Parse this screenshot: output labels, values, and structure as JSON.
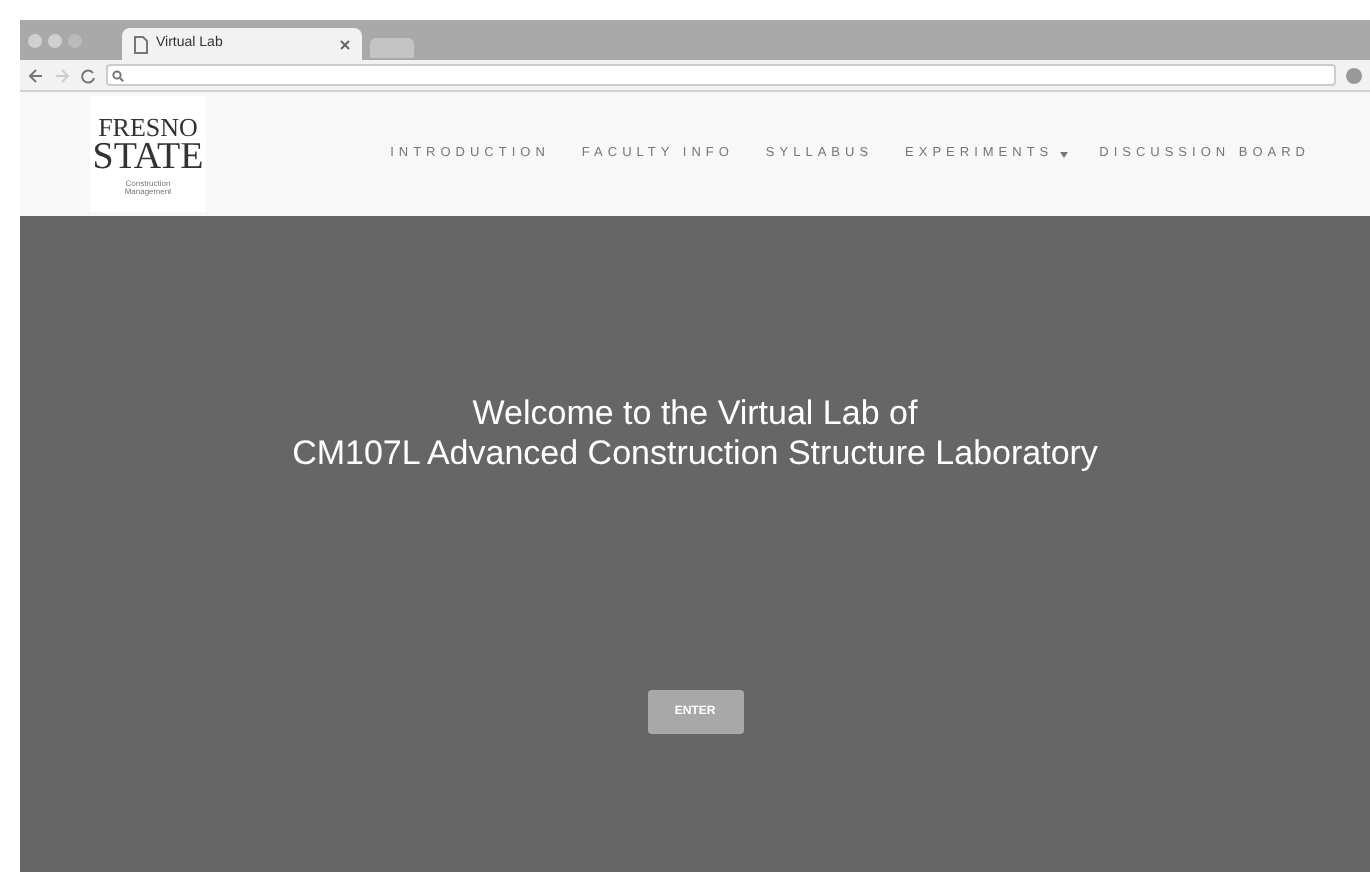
{
  "browser": {
    "tab_title": "Virtual Lab"
  },
  "logo": {
    "line_1": "FRESNO",
    "line_2": "STATE",
    "subtitle": "Construction Management"
  },
  "nav": [
    {
      "label": "INTRODUCTION",
      "kind": "link"
    },
    {
      "label": "FACULTY INFO",
      "kind": "link"
    },
    {
      "label": "SYLLABUS",
      "kind": "link"
    },
    {
      "label": "EXPERIMENTS",
      "kind": "dropdown"
    },
    {
      "label": "DISCUSSION BOARD",
      "kind": "link"
    }
  ],
  "hero": {
    "title_line_1": "Welcome to the Virtual Lab of",
    "title_line_2": "CM107L Advanced Construction Structure Laboratory",
    "button": "ENTER"
  }
}
